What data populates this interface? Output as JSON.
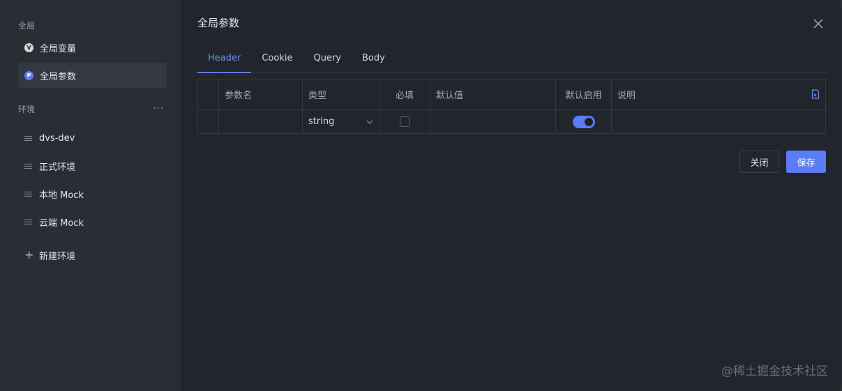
{
  "sidebar": {
    "global_section": "全局",
    "global_items": [
      {
        "label": "全局变量",
        "icon": "v-circle-icon",
        "icon_glyph": "V"
      },
      {
        "label": "全局参数",
        "icon": "p-circle-icon",
        "icon_glyph": "P",
        "active": true
      }
    ],
    "env_section": "环境",
    "env_more": "···",
    "env_items": [
      {
        "label": "dvs-dev"
      },
      {
        "label": "正式环境"
      },
      {
        "label": "本地 Mock"
      },
      {
        "label": "云端 Mock"
      }
    ],
    "add_env_label": "新建环境"
  },
  "main": {
    "title": "全局参数",
    "tabs": [
      {
        "label": "Header",
        "active": true
      },
      {
        "label": "Cookie"
      },
      {
        "label": "Query"
      },
      {
        "label": "Body"
      }
    ],
    "table": {
      "headers": [
        "",
        "参数名",
        "类型",
        "必填",
        "默认值",
        "默认启用",
        "说明"
      ],
      "rows": [
        {
          "name": "",
          "type": "string",
          "required": false,
          "default": "",
          "enabled": true,
          "description": ""
        }
      ]
    },
    "buttons": {
      "close": "关闭",
      "save": "保存"
    }
  },
  "watermark": "@稀土掘金技术社区",
  "colors": {
    "accent": "#5b7cf7",
    "background": "#22252b",
    "sidebar": "#2a2d33"
  }
}
